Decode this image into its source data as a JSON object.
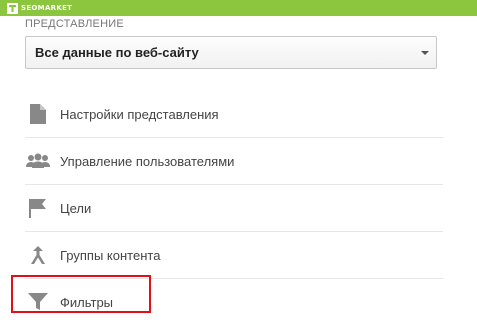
{
  "brand": {
    "name": "SEOMARKET"
  },
  "section": {
    "label": "ПРЕДСТАВЛЕНИЕ"
  },
  "view_select": {
    "value": "Все данные по веб-сайту"
  },
  "menu": {
    "items": [
      {
        "label": "Настройки представления",
        "icon": "document-icon"
      },
      {
        "label": "Управление пользователями",
        "icon": "users-icon"
      },
      {
        "label": "Цели",
        "icon": "flag-icon"
      },
      {
        "label": "Группы контента",
        "icon": "content-groups-icon"
      },
      {
        "label": "Фильтры",
        "icon": "filter-icon"
      }
    ]
  },
  "colors": {
    "topbar": "#8cc63f",
    "highlight": "#e0101a",
    "icon": "#888888"
  }
}
